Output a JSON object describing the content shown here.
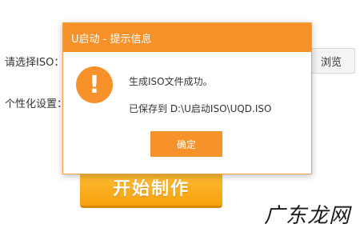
{
  "form": {
    "iso_label": "请选择ISO：",
    "personal_label": "个性化设置：",
    "browse_label": "浏览",
    "start_label": "开始制作"
  },
  "dialog": {
    "title": "U启动 - 提示信息",
    "icon": "exclamation-icon",
    "icon_glyph": "!",
    "message_1": "生成ISO文件成功。",
    "message_2": "已保存到 D:\\U启动ISO\\UQD.ISO",
    "ok_label": "确定"
  },
  "watermark": "广东龙网",
  "colors": {
    "accent": "#f7922a",
    "start_button": "#f7a10c"
  }
}
